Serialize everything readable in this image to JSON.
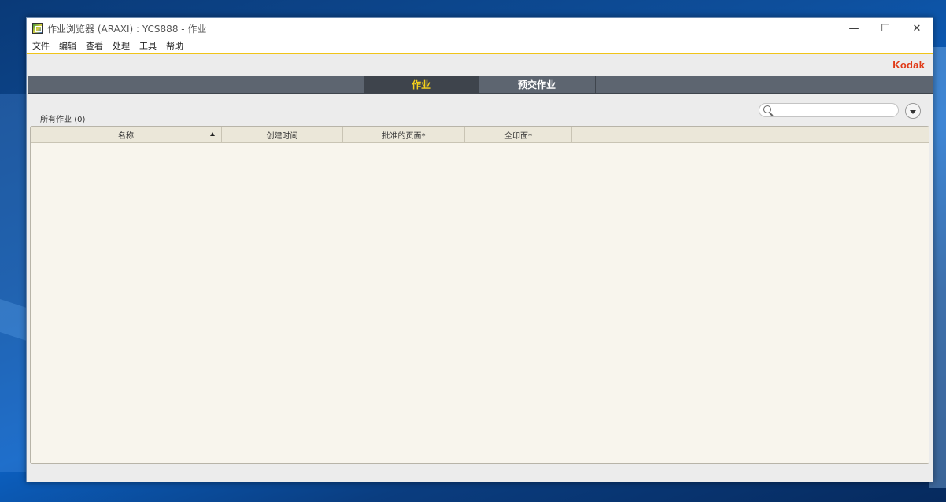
{
  "window": {
    "title": "作业浏览器 (ARAXI) : YCS888 - 作业",
    "controls": {
      "minimize": "—",
      "maximize": "☐",
      "close": "✕"
    }
  },
  "menu": [
    "文件",
    "编辑",
    "查看",
    "处理",
    "工具",
    "帮助"
  ],
  "brand": "Kodak",
  "tabs": [
    {
      "label": "作业",
      "active": true
    },
    {
      "label": "预交作业",
      "active": false
    }
  ],
  "list": {
    "title": "所有作业",
    "count": "(0)"
  },
  "search": {
    "placeholder": "",
    "value": ""
  },
  "table": {
    "columns": [
      "名称",
      "创建时间",
      "批准的页面*",
      "全印面*"
    ],
    "sort": {
      "column": "名称",
      "direction": "ascending"
    },
    "rows": []
  },
  "colors": {
    "accent": "#f0c419",
    "tab_active_text": "#f4d11c",
    "brand": "#e03a17",
    "tabbar": "#5d6570"
  },
  "icons": [
    "app-icon",
    "search-icon",
    "chevron-down-icon",
    "sort-ascending-icon"
  ]
}
